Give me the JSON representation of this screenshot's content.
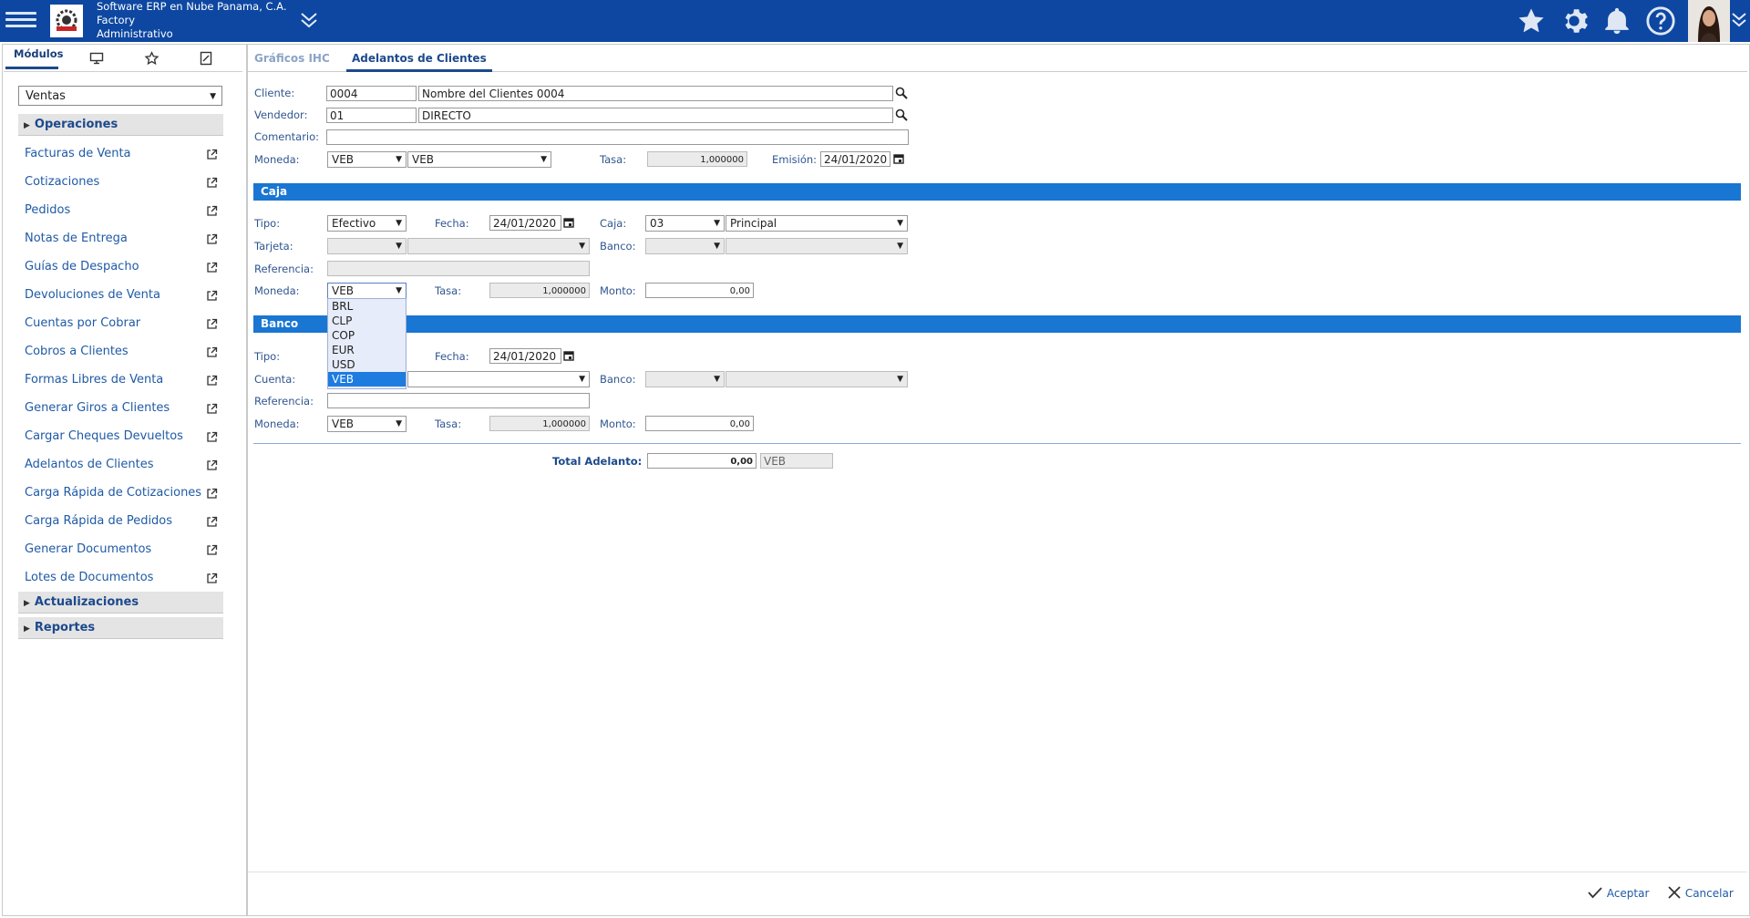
{
  "header": {
    "company": "Software ERP en Nube Panama, C.A.",
    "branch": "Factory",
    "role": "Administrativo",
    "icons": [
      "menu-icon",
      "star-icon",
      "gear-icon",
      "bell-icon",
      "help-icon",
      "chevron-down-icon"
    ]
  },
  "left_tabs": {
    "modules": "Módulos"
  },
  "module_select": "Ventas",
  "groups": {
    "operaciones": "Operaciones",
    "actualizaciones": "Actualizaciones",
    "reportes": "Reportes"
  },
  "menu_items": [
    "Facturas de Venta",
    "Cotizaciones",
    "Pedidos",
    "Notas de Entrega",
    "Guías de Despacho",
    "Devoluciones de Venta",
    "Cuentas por Cobrar",
    "Cobros a Clientes",
    "Formas Libres de Venta",
    "Generar Giros a Clientes",
    "Cargar Cheques Devueltos",
    "Adelantos de Clientes",
    "Carga Rápida de Cotizaciones",
    "Carga Rápida de Pedidos",
    "Generar Documentos",
    "Lotes de Documentos"
  ],
  "tabs": {
    "graficos": "Gráficos IHC",
    "adelantos": "Adelantos de Clientes"
  },
  "form": {
    "cliente_label": "Cliente:",
    "cliente_code": "0004",
    "cliente_name": "Nombre del Clientes 0004",
    "vendedor_label": "Vendedor:",
    "vendedor_code": "01",
    "vendedor_name": "DIRECTO",
    "comentario_label": "Comentario:",
    "moneda_label": "Moneda:",
    "moneda_code": "VEB",
    "moneda_name": "VEB",
    "tasa_label": "Tasa:",
    "tasa_value": "1,000000",
    "emision_label": "Emisión:",
    "emision_value": "24/01/2020"
  },
  "caja": {
    "title": "Caja",
    "tipo_label": "Tipo:",
    "tipo_value": "Efectivo",
    "fecha_label": "Fecha:",
    "fecha_value": "24/01/2020",
    "caja_label": "Caja:",
    "caja_code": "03",
    "caja_name": "Principal",
    "tarjeta_label": "Tarjeta:",
    "banco_label": "Banco:",
    "referencia_label": "Referencia:",
    "moneda_label": "Moneda:",
    "moneda_value": "VEB",
    "tasa_label": "Tasa:",
    "tasa_value": "1,000000",
    "monto_label": "Monto:",
    "monto_value": "0,00",
    "currency_options": [
      "BRL",
      "CLP",
      "COP",
      "EUR",
      "USD",
      "VEB"
    ],
    "currency_selected": "VEB"
  },
  "banco": {
    "title": "Banco",
    "tipo_label": "Tipo:",
    "fecha_label": "Fecha:",
    "fecha_value": "24/01/2020",
    "cuenta_label": "Cuenta:",
    "banco_label": "Banco:",
    "referencia_label": "Referencia:",
    "moneda_label": "Moneda:",
    "moneda_value": "VEB",
    "tasa_label": "Tasa:",
    "tasa_value": "1,000000",
    "monto_label": "Monto:",
    "monto_value": "0,00"
  },
  "total": {
    "label": "Total Adelanto:",
    "value": "0,00",
    "currency": "VEB"
  },
  "footer": {
    "accept": "Aceptar",
    "cancel": "Cancelar"
  },
  "colors": {
    "topbar": "#0d47a1",
    "section": "#1976d2",
    "selected_option": "#1e7ce0",
    "dropdown_bg": "#e6ecf9"
  }
}
